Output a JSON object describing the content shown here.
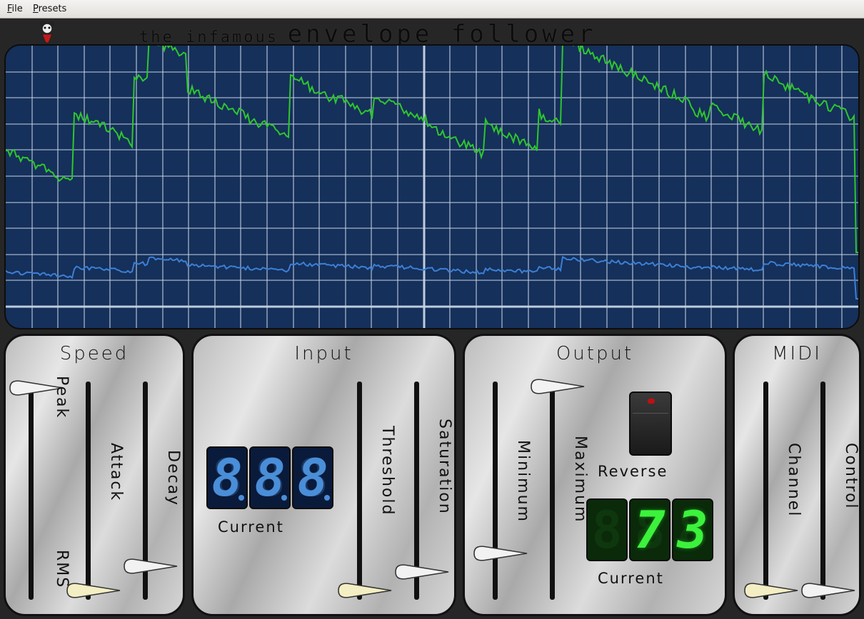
{
  "menu": {
    "file": "File",
    "presets": "Presets"
  },
  "header": {
    "title_small": "the infamous",
    "title_large": "envelope follower"
  },
  "colors": {
    "scope_bg": "#15305a",
    "grid": "#c8d4e6",
    "envelope": "#2ec62e",
    "input": "#3c7fd6"
  },
  "speed": {
    "title": "Speed",
    "peak_label": "Peak",
    "rms_label": "RMS",
    "attack_label": "Attack",
    "decay_label": "Decay"
  },
  "input": {
    "title": "Input",
    "current_label": "Current",
    "display_digits": [
      "8",
      "8",
      "8"
    ],
    "threshold_label": "Threshold",
    "saturation_label": "Saturation"
  },
  "output": {
    "title": "Output",
    "minimum_label": "Minimum",
    "maximum_label": "Maximum",
    "reverse_label": "Reverse",
    "current_label": "Current",
    "display_value": "73"
  },
  "midi": {
    "title": "MIDI",
    "channel_label": "Channel",
    "control_label": "Control"
  }
}
